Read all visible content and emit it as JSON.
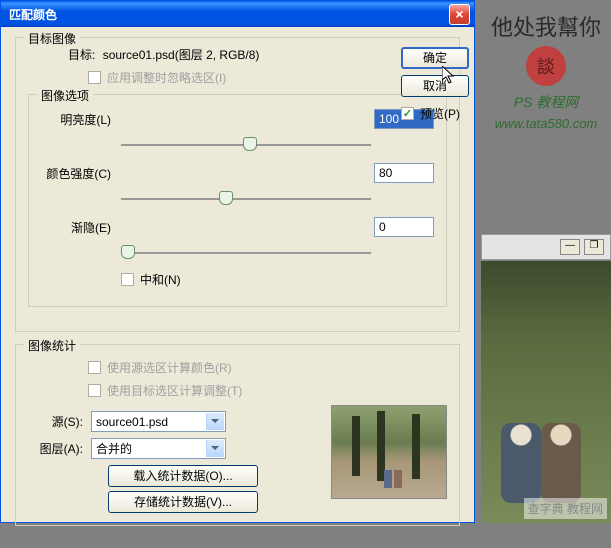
{
  "dialog": {
    "title": "匹配颜色",
    "target_group": {
      "legend": "目标图像",
      "target_label": "目标:",
      "target_value": "source01.psd(图层 2, RGB/8)",
      "ignore_sel": "应用调整时忽略选区(I)"
    },
    "options_group": {
      "legend": "图像选项",
      "luminance_label": "明亮度(L)",
      "luminance_value": "100",
      "intensity_label": "颜色强度(C)",
      "intensity_value": "80",
      "fade_label": "渐隐(E)",
      "fade_value": "0",
      "neutralize": "中和(N)"
    },
    "stats_group": {
      "legend": "图像统计",
      "use_source_sel": "使用源选区计算颜色(R)",
      "use_target_sel": "使用目标选区计算调整(T)",
      "source_label": "源(S):",
      "source_value": "source01.psd",
      "layer_label": "图层(A):",
      "layer_value": "合并的",
      "load_stats": "载入统计数据(O)...",
      "save_stats": "存储统计数据(V)..."
    },
    "buttons": {
      "ok": "确定",
      "cancel": "取消",
      "preview": "预览(P)"
    }
  },
  "branding": {
    "site": "PS 教程网",
    "url": "www.tata580.com"
  },
  "watermark": "查字典 教程网"
}
